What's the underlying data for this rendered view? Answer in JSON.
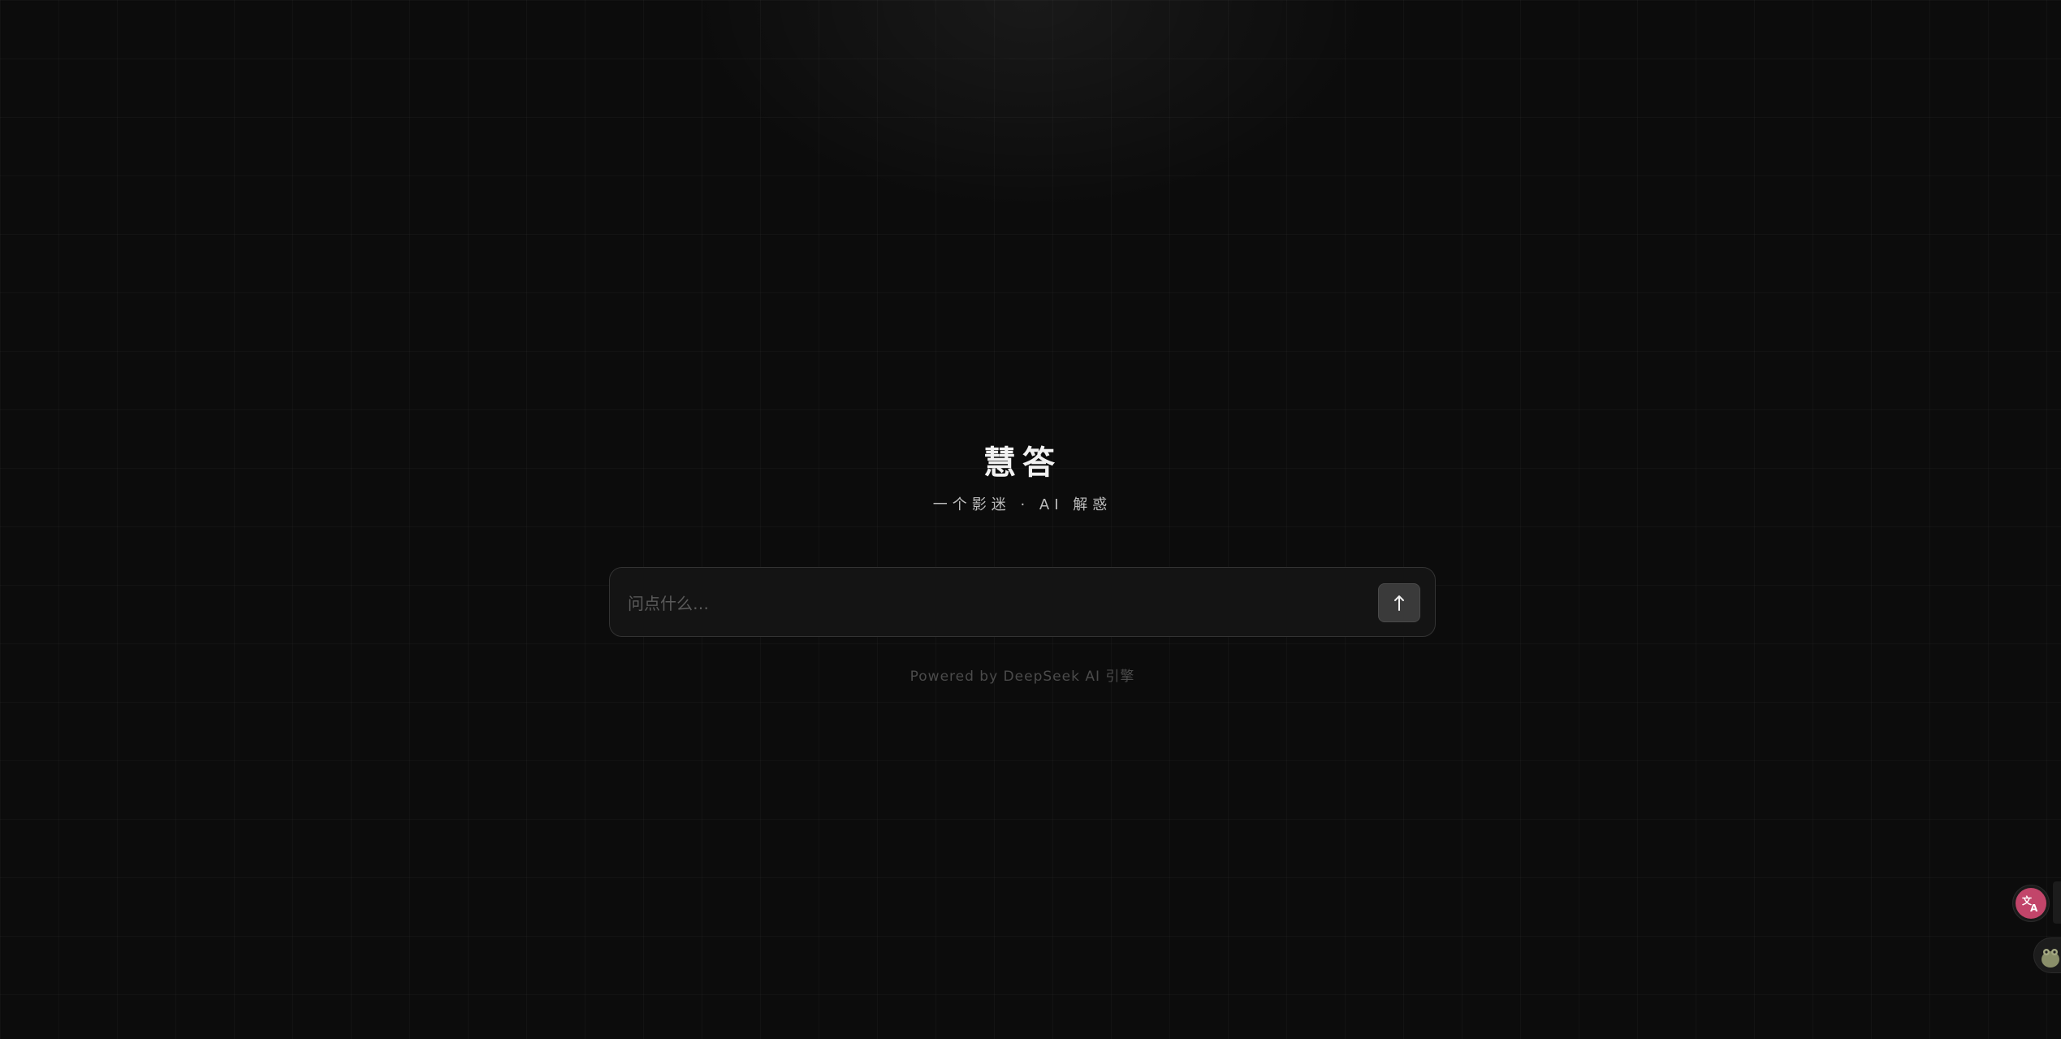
{
  "app": {
    "title": "慧答",
    "subtitle": "一个影迷 · AI 解惑"
  },
  "search": {
    "placeholder": "问点什么…",
    "value": ""
  },
  "send_button": {
    "icon": "arrow-up-icon",
    "glyph": "↑"
  },
  "footer": {
    "text": "Powered by DeepSeek AI 引擎"
  },
  "floating_widgets": [
    {
      "icon": "translate-icon",
      "accent": "#c2456a"
    },
    {
      "icon": "frog-mascot-icon"
    }
  ],
  "colors": {
    "background": "#0c0c0c",
    "input_background": "#141414",
    "input_border": "#333333",
    "button_background": "#3a3a3a",
    "title": "#f2f2f2"
  }
}
